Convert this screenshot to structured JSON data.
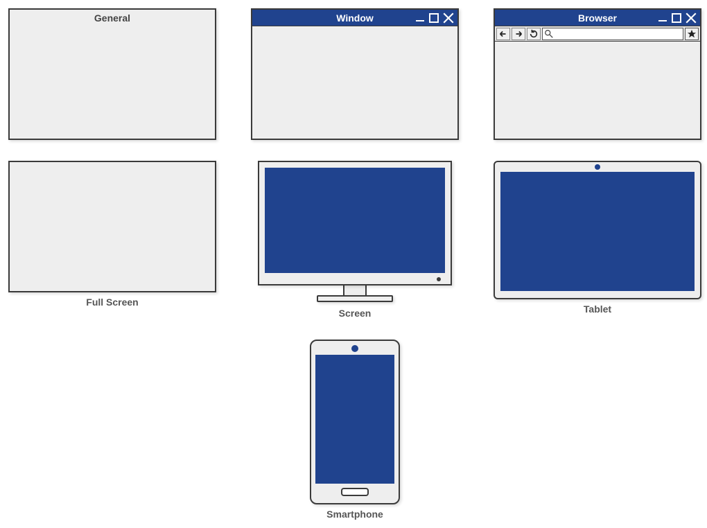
{
  "shapes": {
    "general": {
      "label": "General"
    },
    "window": {
      "label": "Window"
    },
    "browser": {
      "label": "Browser"
    },
    "fullscreen": {
      "label": "Full Screen"
    },
    "screen": {
      "label": "Screen"
    },
    "tablet": {
      "label": "Tablet"
    },
    "smartphone": {
      "label": "Smartphone"
    }
  },
  "colors": {
    "accent": "#20438e",
    "frame": "#3a3a3a",
    "fill": "#eeeeee"
  }
}
